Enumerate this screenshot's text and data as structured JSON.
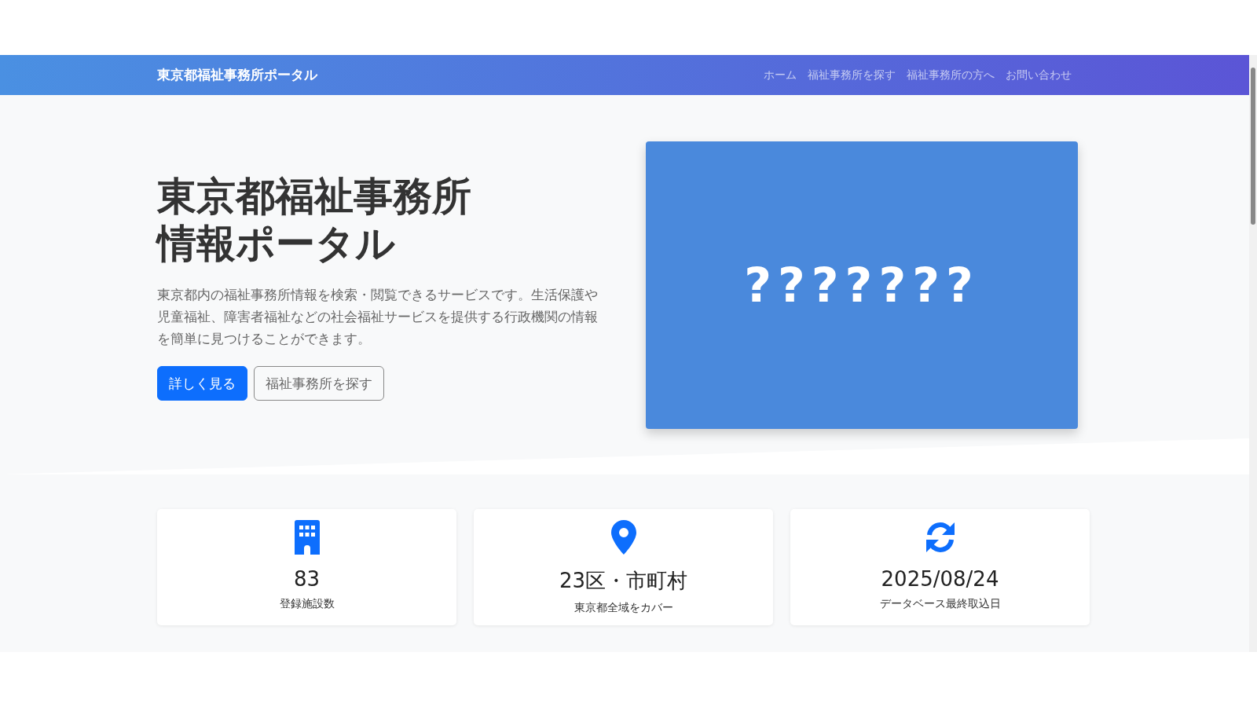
{
  "navbar": {
    "brand": "東京都福祉事務所ポータル",
    "links": [
      "ホーム",
      "福祉事務所を探す",
      "福祉事務所の方へ",
      "お問い合わせ"
    ]
  },
  "hero": {
    "title_lines": [
      "東京都福祉事務所",
      "情報ポータル"
    ],
    "description": "東京都内の福祉事務所情報を検索・閲覧できるサービスです。生活保護や児童福祉、障害者福祉などの社会福祉サービスを提供する行政機関の情報を簡単に見つけることができます。",
    "buttons": [
      {
        "label": "詳しく見る",
        "kind": "primary"
      },
      {
        "label": "福祉事務所を探す",
        "kind": "outline"
      }
    ],
    "image_text": "???????"
  },
  "stats": [
    {
      "kind": "building",
      "value": "83",
      "label": "登録施設数"
    },
    {
      "kind": "pin",
      "value": "23区・市町村",
      "label": "東京都全域をカバー"
    },
    {
      "kind": "sync",
      "value": "2025/08/24",
      "label": "データベース最終取込日"
    }
  ]
}
